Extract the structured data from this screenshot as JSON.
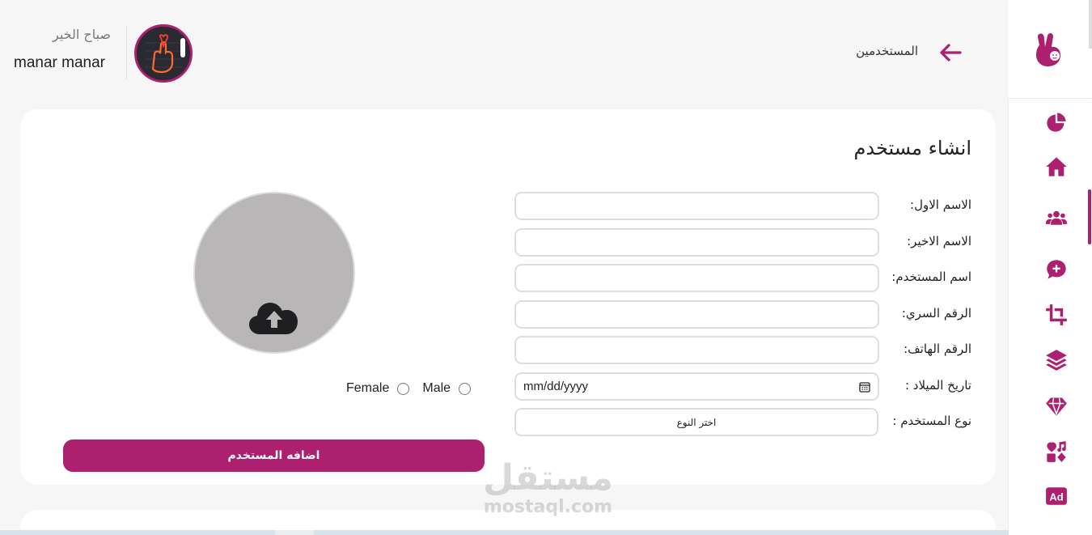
{
  "header": {
    "title": "المستخدمين",
    "greeting": "صباح الخير",
    "username": "manar manar"
  },
  "form": {
    "title": "انشاء مستخدم",
    "fields": [
      {
        "label": "الاسم الاول:",
        "value": ""
      },
      {
        "label": "الاسم الاخير:",
        "value": ""
      },
      {
        "label": "اسم المستخدم:",
        "value": ""
      },
      {
        "label": "الرقم السري:",
        "value": ""
      },
      {
        "label": "الرقم الهاتف:",
        "value": ""
      },
      {
        "label": "تاريخ الميلاد :",
        "placeholder": "mm/dd/yyyy"
      },
      {
        "label": "نوع المستخدم :",
        "selected": "اختر النوع"
      }
    ],
    "gender": {
      "female": "Female",
      "male": "Male"
    },
    "submit_label": "اضافه المستخدم"
  },
  "sidebar": {
    "items": [
      {
        "icon": "pie-chart-icon"
      },
      {
        "icon": "home-icon"
      },
      {
        "icon": "users-icon",
        "active": true
      },
      {
        "icon": "chat-plus-icon"
      },
      {
        "icon": "crop-icon"
      },
      {
        "icon": "layers-icon"
      },
      {
        "icon": "diamond-icon"
      },
      {
        "icon": "heart-music-icon"
      },
      {
        "icon": "ad-icon"
      }
    ]
  },
  "watermark": {
    "arabic": "مستقل",
    "latin": "mostaql.com"
  },
  "colors": {
    "accent": "#ad1f6f",
    "background": "#f6f6f6",
    "upload_circle": "#b8b6b7"
  }
}
